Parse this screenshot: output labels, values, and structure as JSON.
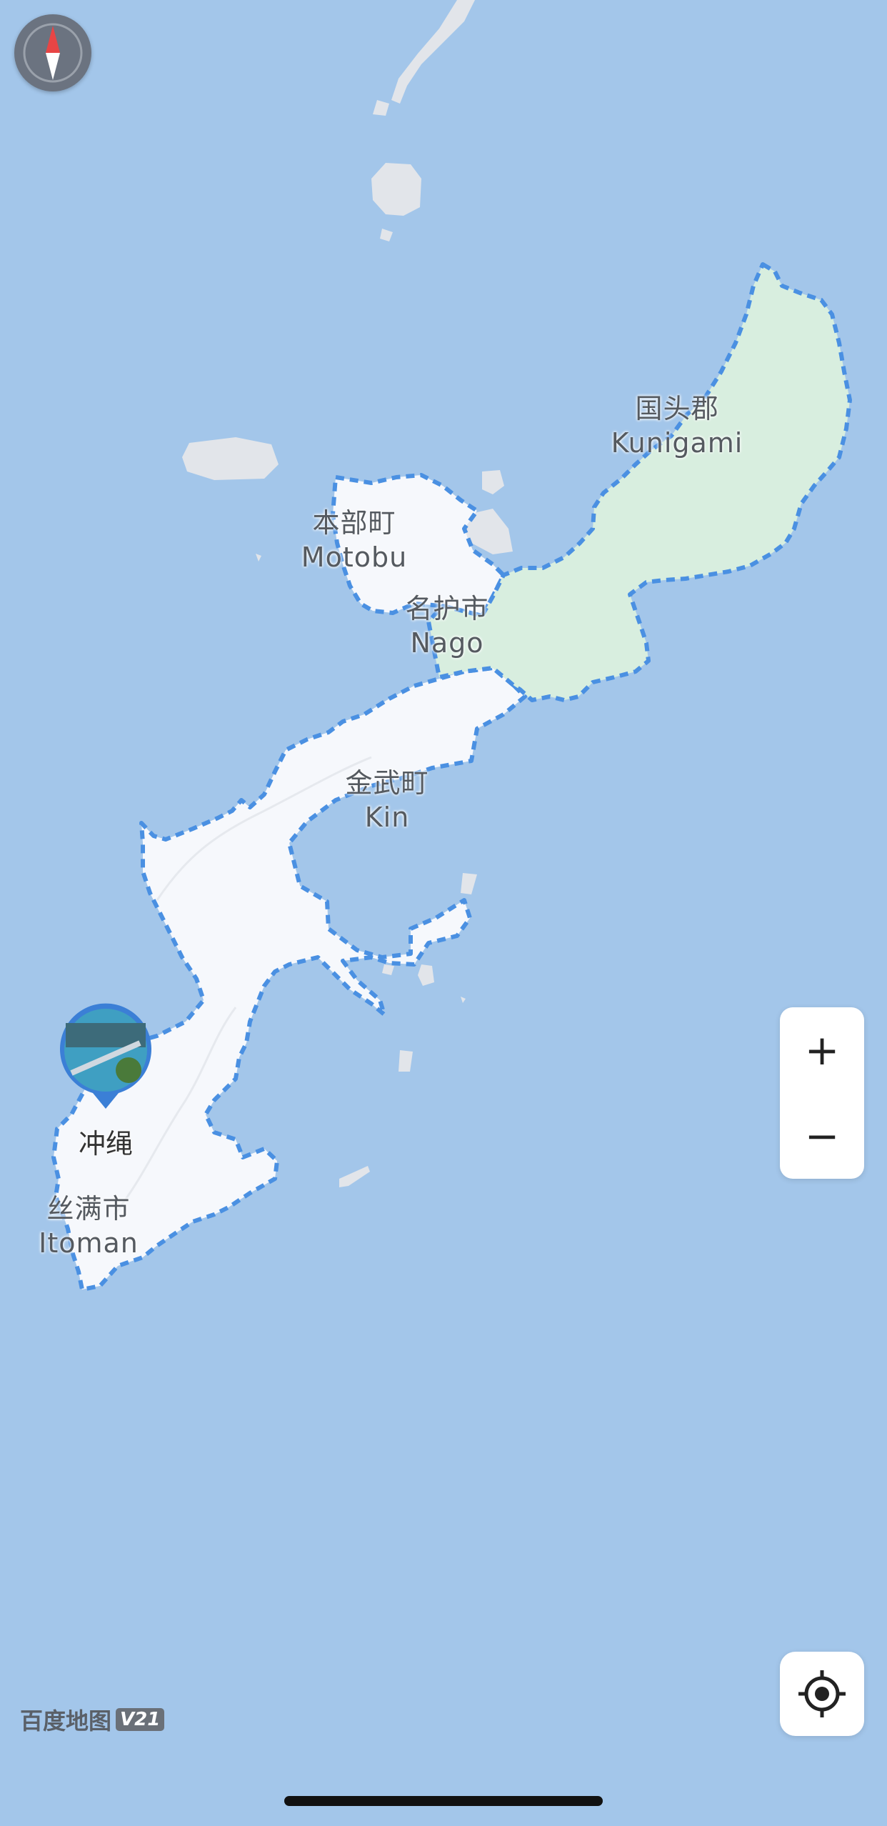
{
  "map": {
    "regions": [
      {
        "name_zh": "国头郡",
        "name_en": "Kunigami"
      },
      {
        "name_zh": "本部町",
        "name_en": "Motobu"
      },
      {
        "name_zh": "名护市",
        "name_en": "Nago"
      },
      {
        "name_zh": "金武町",
        "name_en": "Kin"
      },
      {
        "name_zh": "丝满市",
        "name_en": "Itoman"
      }
    ],
    "poi": {
      "label": "冲绳"
    },
    "colors": {
      "water": "#a3c6ea",
      "land": "#f6f8fc",
      "forest": "#d8eedf",
      "island_gray": "#e2e5ea",
      "boundary": "#4a90e2"
    }
  },
  "controls": {
    "compass_icon": "compass-icon",
    "zoom_in_label": "+",
    "zoom_out_label": "−",
    "locate_icon": "locate-crosshair-icon"
  },
  "branding": {
    "name": "百度地图",
    "version": "V21"
  }
}
